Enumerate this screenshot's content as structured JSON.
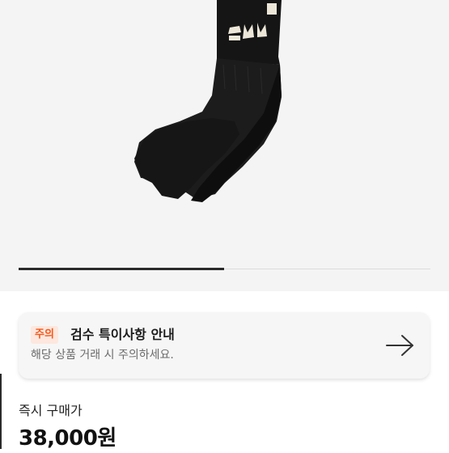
{
  "hero": {
    "image_icon": "black-sock-icon"
  },
  "notice": {
    "badge": "주의",
    "title": "검수 특이사항 안내",
    "description": "해당 상품 거래 시 주의하세요.",
    "arrow_icon": "arrow-right-icon",
    "badge_color": "#f25a1e",
    "badge_bg": "#fde7de"
  },
  "price": {
    "label": "즉시 구매가",
    "value": "38,000원"
  }
}
